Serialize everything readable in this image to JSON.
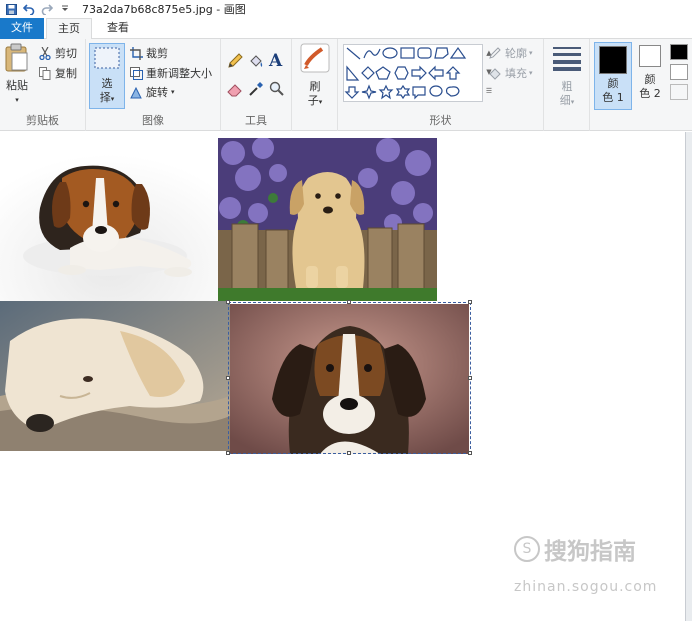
{
  "window": {
    "title": "73a2da7b68c875e5.jpg - 画图"
  },
  "tabs": [
    {
      "label": "文件"
    },
    {
      "label": "主页"
    },
    {
      "label": "查看"
    }
  ],
  "ribbon": {
    "clipboard": {
      "paste_label": "粘贴",
      "cut_label": "剪切",
      "copy_label": "复制",
      "group_label": "剪贴板"
    },
    "image": {
      "select_label_1": "选",
      "select_label_2": "择",
      "crop_label": "裁剪",
      "resize_label": "重新调整大小",
      "rotate_label": "旋转",
      "group_label": "图像"
    },
    "tools": {
      "text_glyph": "A",
      "group_label": "工具"
    },
    "brushes": {
      "label_1": "刷",
      "label_2": "子"
    },
    "shapes": {
      "outline_label": "轮廓",
      "fill_label": "填充",
      "group_label": "形状"
    },
    "size": {
      "label_1": "粗",
      "label_2": "细"
    },
    "colors": {
      "color1_label_1": "颜",
      "color1_label_2": "色 1",
      "color2_label_1": "颜",
      "color2_label_2": "色 2",
      "color1": "#000000",
      "color2": "#ffffff"
    }
  },
  "watermark": {
    "brand": "搜狗指南",
    "url": "zhinan.sogou.com"
  },
  "theme": {
    "file_tab": "#1979ca",
    "selection_border": "#3c5fa0"
  }
}
